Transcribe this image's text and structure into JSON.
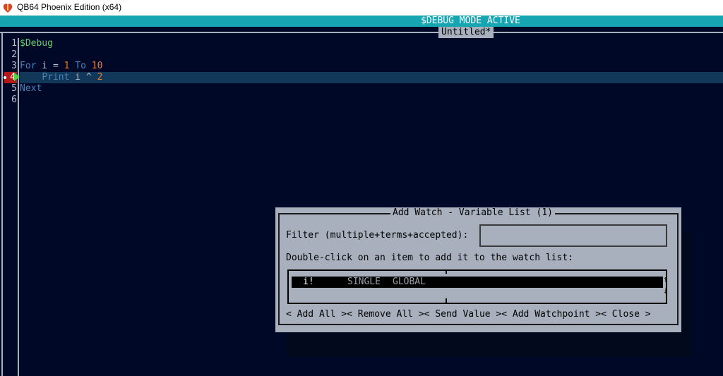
{
  "window": {
    "title": "QB64 Phoenix Edition (x64)"
  },
  "ide": {
    "mode_banner": "$DEBUG MODE ACTIVE",
    "tab_title": "Untitled*",
    "line_numbers": [
      "1",
      "2",
      "3",
      "4",
      "5",
      "6"
    ],
    "current_line": "4"
  },
  "code": {
    "l1": "$Debug",
    "l3_for": "For",
    "l3_var": " i = ",
    "l3_start": "1",
    "l3_to": " To ",
    "l3_end": "10",
    "l4_indent": "    ",
    "l4_print": "Print",
    "l4_expr": " i ^ ",
    "l4_exp": "2",
    "l5": "Next"
  },
  "dialog": {
    "title": "Add Watch - Variable List (1)",
    "filter_label": "Filter (multiple+terms+accepted):",
    "filter_value": "",
    "instructions": "Double-click on an item to add it to the watch list:",
    "items": [
      {
        "name": "i!",
        "type": "SINGLE",
        "scope": "GLOBAL"
      }
    ],
    "buttons": {
      "add_all": "< Add All >",
      "remove_all": "< Remove All >",
      "send_value": "< Send Value >",
      "add_watchpoint": "< Add Watchpoint >",
      "close": "< Close >"
    },
    "scroll_up": "↑",
    "scroll_down": "↓"
  },
  "colors": {
    "editor_bg": "#000828",
    "banner": "#17a5b2",
    "dialog_bg": "#a9b0bd",
    "current_line_bg": "#113858",
    "breakpoint": "#b51a1a"
  }
}
